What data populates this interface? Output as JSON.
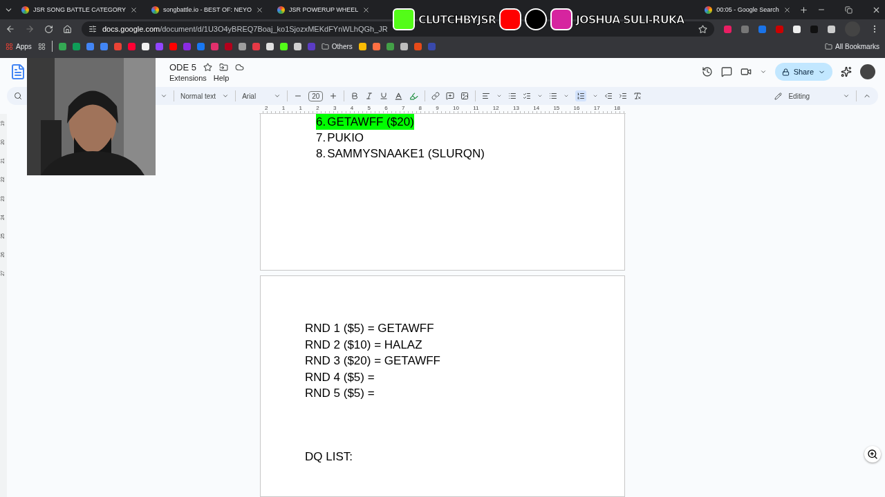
{
  "tabs": [
    {
      "title": "JSR SONG BATTLE CATEGORY",
      "selected": false
    },
    {
      "title": "songbattle.io - BEST OF: NEYO",
      "selected": false
    },
    {
      "title": "JSR POWERUP WHEEL",
      "selected": false
    },
    {
      "title": "00:05 - Google Search",
      "selected": false
    }
  ],
  "stream_overlay": {
    "channel": "CLUTCHBYJSR",
    "name": "JOSHUA SULI-RUKA"
  },
  "address_bar": {
    "host": "docs.google.com",
    "path": "/document/d/1U3O4yBREQ7Boaj_ko1SjozxMEKdFYnWLhQGh_JR"
  },
  "bookmarks": {
    "apps": "Apps",
    "folder": "Others",
    "all": "All Bookmarks",
    "sites": [
      {
        "color": "#34a853"
      },
      {
        "color": "#0f9d58"
      },
      {
        "color": "#4285f4"
      },
      {
        "color": "#4285f4"
      },
      {
        "color": "#ea4335"
      },
      {
        "color": "#ff0033"
      },
      {
        "color": "#f1f1f1"
      },
      {
        "color": "#9146ff"
      },
      {
        "color": "#ff0000"
      },
      {
        "color": "#8a2be2"
      },
      {
        "color": "#1877f2"
      },
      {
        "color": "#e1306c"
      },
      {
        "color": "#b3001b"
      },
      {
        "color": "#9e9e9e"
      },
      {
        "color": "#e63946"
      },
      {
        "color": "#e0e0e0"
      },
      {
        "color": "#53fc18"
      },
      {
        "color": "#d0d0d0"
      },
      {
        "color": "#5b3cc4"
      },
      {
        "color": "#fbbc04"
      },
      {
        "color": "#ff7043"
      },
      {
        "color": "#43a047"
      },
      {
        "color": "#bdbdbd"
      },
      {
        "color": "#e64a19"
      },
      {
        "color": "#3949ab"
      }
    ]
  },
  "document": {
    "title": "ODE 5",
    "menus": [
      "Extensions",
      "Help"
    ]
  },
  "toolbar": {
    "style": "Normal text",
    "font": "Arial",
    "font_size": "20",
    "numbered_list_selected": true,
    "mode": "Editing"
  },
  "share_button": "Share",
  "ruler": [
    "2",
    "1",
    "1",
    "2",
    "3",
    "4",
    "5",
    "6",
    "7",
    "8",
    "9",
    "10",
    "11",
    "12",
    "13",
    "14",
    "15",
    "16",
    "17",
    "18"
  ],
  "side_ruler": [
    "19",
    "20",
    "21",
    "22",
    "23",
    "24",
    "25",
    "26",
    "27"
  ],
  "page_one_list": [
    {
      "number": "6.",
      "text": "GETAWFF ($20)",
      "highlighted": true
    },
    {
      "number": "7.",
      "text": "PUKIO",
      "highlighted": false
    },
    {
      "number": "8.",
      "text": "SAMMYSNAAKE1 (SLURQN)",
      "highlighted": false
    }
  ],
  "page_two_lines": [
    "RND 1 ($5) = GETAWFF",
    "RND 2 ($10) = HALAZ",
    "RND 3 ($20) = GETAWFF",
    "RND 4 ($5) =",
    "RND 5 ($5) ="
  ],
  "dq_heading": "DQ LIST:"
}
